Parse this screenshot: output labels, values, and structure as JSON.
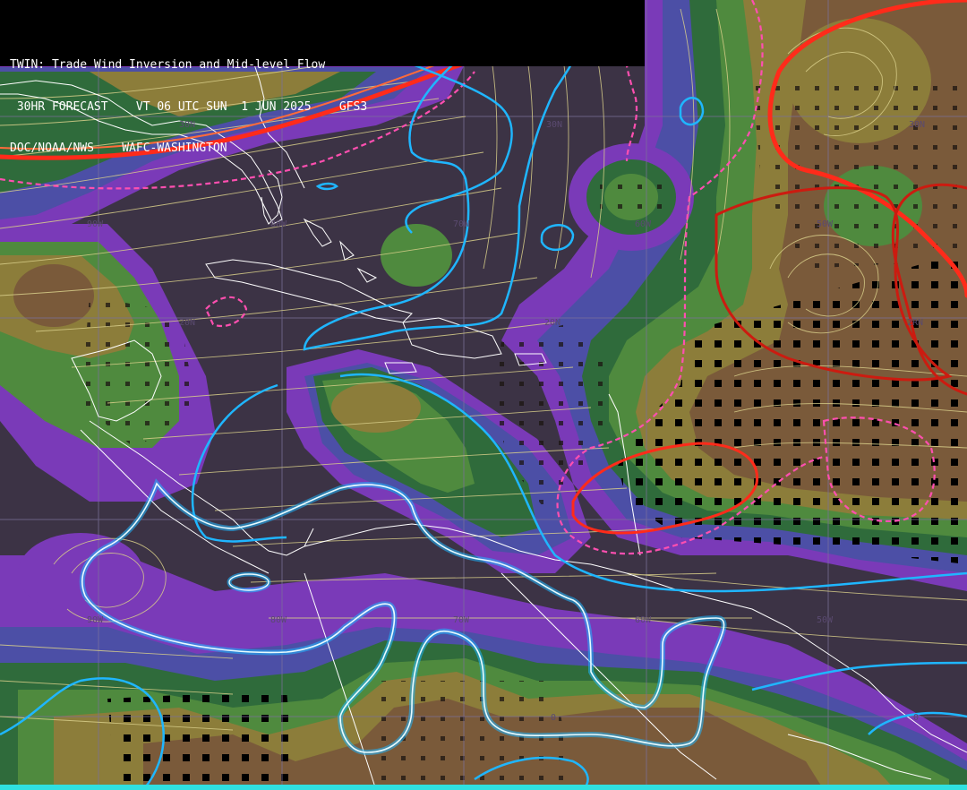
{
  "header": {
    "line1": "TWIN: Trade Wind Inversion and Mid-level Flow",
    "line2": " 30HR FORECAST    VT 06 UTC SUN  1 JUN 2025    GFS3",
    "line3": "DOC/NOAA/NWS    WAFC-WASHINGTON"
  },
  "grid_labels": {
    "lat": [
      "30N",
      "30N",
      "30N",
      "20N",
      "20N",
      "2RN"
    ],
    "lon_top": [
      "90W",
      "80W",
      "70W",
      "60W",
      "50W"
    ],
    "lon_bottom": [
      "90W",
      "80W",
      "70W",
      "60W",
      "50W"
    ],
    "eq": [
      "0",
      "0"
    ]
  },
  "colors": {
    "background": "#3c3345",
    "purple": "#7a3ab8",
    "blue_purple": "#4c4fa6",
    "dark_green": "#2f6b3b",
    "green": "#4f8a3e",
    "olive": "#8c7d3a",
    "brown": "#7a5a3a",
    "jet": "#ff2b1a",
    "cyan_line": "#1fb6ff",
    "pink_dash": "#ff4fb0",
    "coast": "#ffffff",
    "streamline": "#d9cf8a",
    "grid": "#7a6f9a",
    "accent_bar": "#2fe0e0"
  }
}
